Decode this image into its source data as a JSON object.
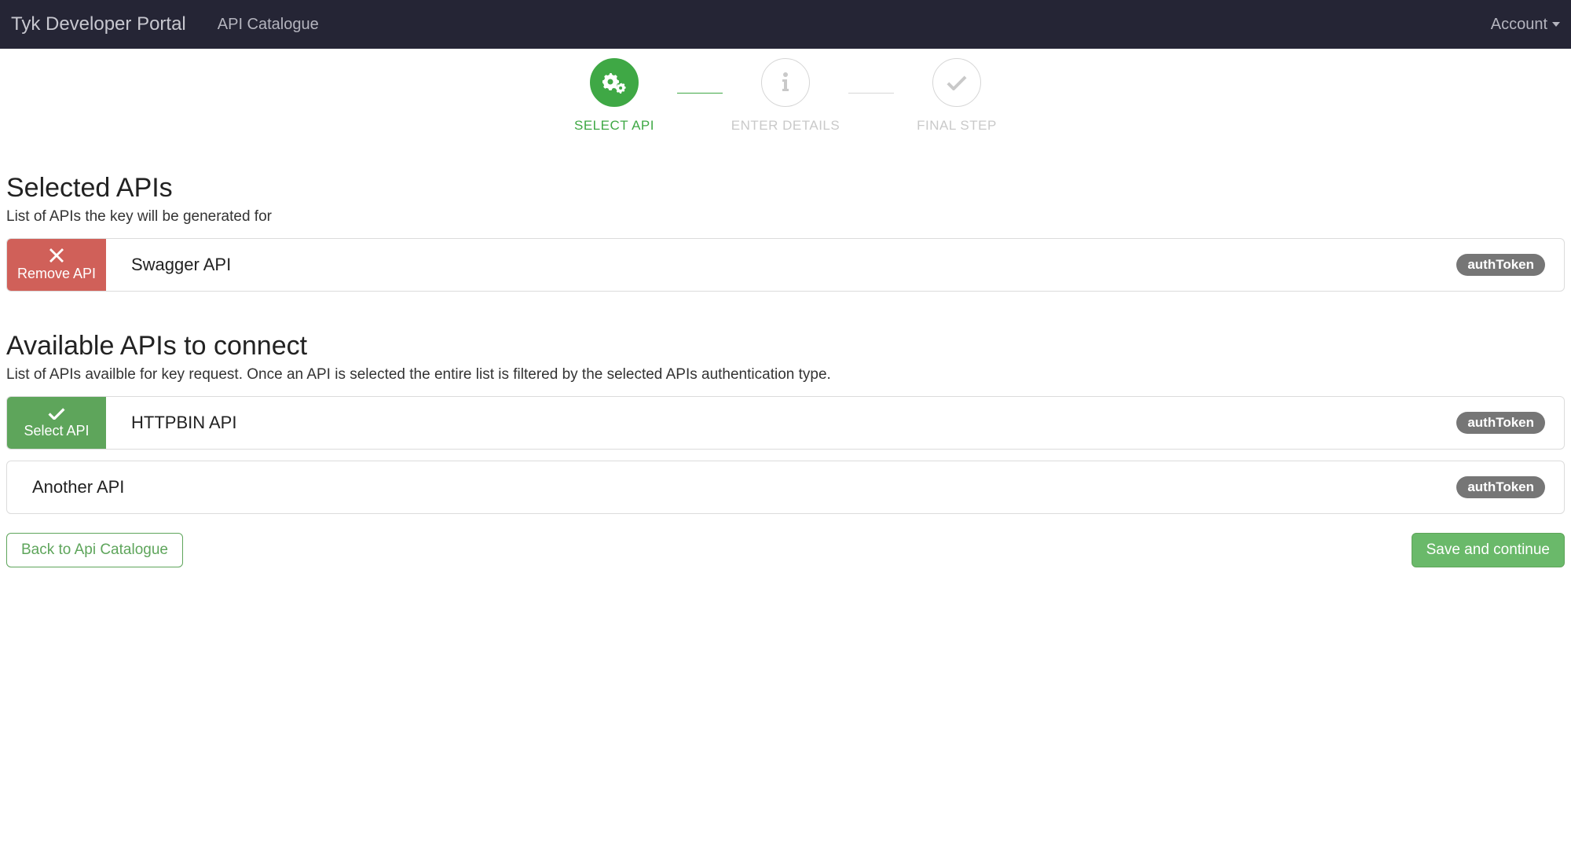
{
  "navbar": {
    "brand": "Tyk Developer Portal",
    "catalogue": "API Catalogue",
    "account": "Account"
  },
  "stepper": {
    "steps": [
      {
        "label": "SELECT API",
        "active": true
      },
      {
        "label": "ENTER DETAILS",
        "active": false
      },
      {
        "label": "FINAL STEP",
        "active": false
      }
    ]
  },
  "selected": {
    "title": "Selected APIs",
    "desc": "List of APIs the key will be generated for",
    "removeLabel": "Remove API",
    "items": [
      {
        "name": "Swagger API",
        "badge": "authToken"
      }
    ]
  },
  "available": {
    "title": "Available APIs to connect",
    "desc": "List of APIs availble for key request. Once an API is selected the entire list is filtered by the selected APIs authentication type.",
    "selectLabel": "Select API",
    "items": [
      {
        "name": "HTTPBIN API",
        "badge": "authToken",
        "showSelect": true
      },
      {
        "name": "Another API",
        "badge": "authToken",
        "showSelect": false
      }
    ]
  },
  "footer": {
    "back": "Back to Api Catalogue",
    "save": "Save and continue"
  }
}
